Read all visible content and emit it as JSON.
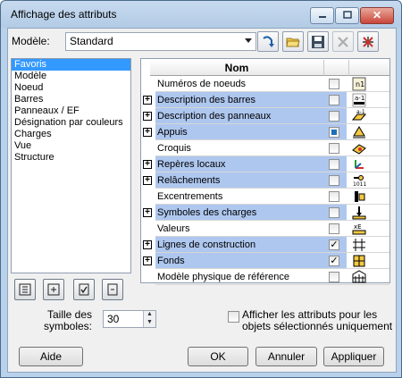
{
  "window": {
    "title": "Affichage des attributs",
    "close_label": "✕"
  },
  "modele": {
    "label": "Modèle:",
    "value": "Standard"
  },
  "toolbar": {
    "icons": [
      "reload-icon",
      "open-folder-icon",
      "save-icon",
      "delete-icon",
      "reset-icon"
    ]
  },
  "categories": [
    {
      "label": "Favoris",
      "selected": true
    },
    {
      "label": "Modèle",
      "selected": false
    },
    {
      "label": "Noeud",
      "selected": false
    },
    {
      "label": "Barres",
      "selected": false
    },
    {
      "label": "Panneaux / EF",
      "selected": false
    },
    {
      "label": "Désignation par couleurs",
      "selected": false
    },
    {
      "label": "Charges",
      "selected": false
    },
    {
      "label": "Vue",
      "selected": false
    },
    {
      "label": "Structure",
      "selected": false
    }
  ],
  "grid": {
    "header": "Nom",
    "rows": [
      {
        "label": "Numéros de noeuds",
        "expandable": false,
        "highlighted": false,
        "checked": "none",
        "icon": "node-numbers-icon"
      },
      {
        "label": "Description des barres",
        "expandable": true,
        "highlighted": true,
        "checked": "none",
        "icon": "bar-description-icon"
      },
      {
        "label": "Description des panneaux",
        "expandable": true,
        "highlighted": true,
        "checked": "none",
        "icon": "panel-description-icon"
      },
      {
        "label": "Appuis",
        "expandable": true,
        "highlighted": true,
        "checked": "partial",
        "icon": "supports-icon"
      },
      {
        "label": "Croquis",
        "expandable": false,
        "highlighted": false,
        "checked": "none",
        "icon": "sketch-icon"
      },
      {
        "label": "Repères locaux",
        "expandable": true,
        "highlighted": true,
        "checked": "none",
        "icon": "local-axes-icon"
      },
      {
        "label": "Relâchements",
        "expandable": true,
        "highlighted": true,
        "checked": "none",
        "icon": "releases-icon"
      },
      {
        "label": "Excentrements",
        "expandable": false,
        "highlighted": false,
        "checked": "none",
        "icon": "offsets-icon"
      },
      {
        "label": "Symboles des charges",
        "expandable": true,
        "highlighted": true,
        "checked": "none",
        "icon": "load-symbols-icon"
      },
      {
        "label": "Valeurs",
        "expandable": false,
        "highlighted": false,
        "checked": "none",
        "icon": "values-icon"
      },
      {
        "label": "Lignes de construction",
        "expandable": true,
        "highlighted": true,
        "checked": "checked",
        "icon": "construction-lines-icon"
      },
      {
        "label": "Fonds",
        "expandable": true,
        "highlighted": true,
        "checked": "checked",
        "icon": "backgrounds-icon"
      },
      {
        "label": "Modèle physique de référence",
        "expandable": false,
        "highlighted": false,
        "checked": "none",
        "icon": "physical-model-icon"
      }
    ]
  },
  "list_buttons": [
    "expand-all-icon",
    "collapse-all-icon",
    "check-all-icon",
    "uncheck-all-icon"
  ],
  "taille": {
    "label_line1": "Taille des",
    "label_line2": "symboles:",
    "value": "30"
  },
  "selected_only": {
    "line1": "Afficher les attributs pour les",
    "line2": "objets sélectionnés uniquement",
    "checked": false
  },
  "buttons": {
    "help": "Aide",
    "ok": "OK",
    "cancel": "Annuler",
    "apply": "Appliquer"
  }
}
